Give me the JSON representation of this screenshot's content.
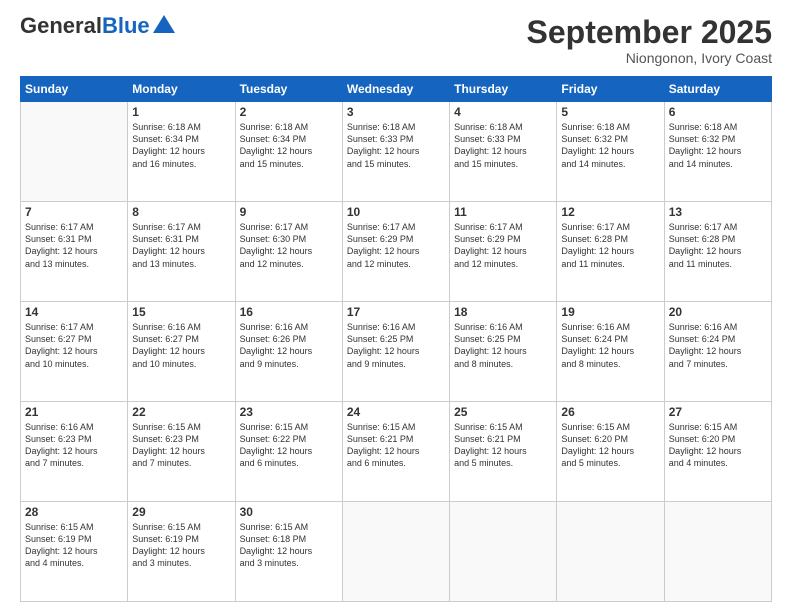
{
  "logo": {
    "general": "General",
    "blue": "Blue"
  },
  "header": {
    "month": "September 2025",
    "location": "Niongonon, Ivory Coast"
  },
  "weekdays": [
    "Sunday",
    "Monday",
    "Tuesday",
    "Wednesday",
    "Thursday",
    "Friday",
    "Saturday"
  ],
  "weeks": [
    [
      {
        "day": "",
        "info": ""
      },
      {
        "day": "1",
        "info": "Sunrise: 6:18 AM\nSunset: 6:34 PM\nDaylight: 12 hours\nand 16 minutes."
      },
      {
        "day": "2",
        "info": "Sunrise: 6:18 AM\nSunset: 6:34 PM\nDaylight: 12 hours\nand 15 minutes."
      },
      {
        "day": "3",
        "info": "Sunrise: 6:18 AM\nSunset: 6:33 PM\nDaylight: 12 hours\nand 15 minutes."
      },
      {
        "day": "4",
        "info": "Sunrise: 6:18 AM\nSunset: 6:33 PM\nDaylight: 12 hours\nand 15 minutes."
      },
      {
        "day": "5",
        "info": "Sunrise: 6:18 AM\nSunset: 6:32 PM\nDaylight: 12 hours\nand 14 minutes."
      },
      {
        "day": "6",
        "info": "Sunrise: 6:18 AM\nSunset: 6:32 PM\nDaylight: 12 hours\nand 14 minutes."
      }
    ],
    [
      {
        "day": "7",
        "info": "Sunrise: 6:17 AM\nSunset: 6:31 PM\nDaylight: 12 hours\nand 13 minutes."
      },
      {
        "day": "8",
        "info": "Sunrise: 6:17 AM\nSunset: 6:31 PM\nDaylight: 12 hours\nand 13 minutes."
      },
      {
        "day": "9",
        "info": "Sunrise: 6:17 AM\nSunset: 6:30 PM\nDaylight: 12 hours\nand 12 minutes."
      },
      {
        "day": "10",
        "info": "Sunrise: 6:17 AM\nSunset: 6:29 PM\nDaylight: 12 hours\nand 12 minutes."
      },
      {
        "day": "11",
        "info": "Sunrise: 6:17 AM\nSunset: 6:29 PM\nDaylight: 12 hours\nand 12 minutes."
      },
      {
        "day": "12",
        "info": "Sunrise: 6:17 AM\nSunset: 6:28 PM\nDaylight: 12 hours\nand 11 minutes."
      },
      {
        "day": "13",
        "info": "Sunrise: 6:17 AM\nSunset: 6:28 PM\nDaylight: 12 hours\nand 11 minutes."
      }
    ],
    [
      {
        "day": "14",
        "info": "Sunrise: 6:17 AM\nSunset: 6:27 PM\nDaylight: 12 hours\nand 10 minutes."
      },
      {
        "day": "15",
        "info": "Sunrise: 6:16 AM\nSunset: 6:27 PM\nDaylight: 12 hours\nand 10 minutes."
      },
      {
        "day": "16",
        "info": "Sunrise: 6:16 AM\nSunset: 6:26 PM\nDaylight: 12 hours\nand 9 minutes."
      },
      {
        "day": "17",
        "info": "Sunrise: 6:16 AM\nSunset: 6:25 PM\nDaylight: 12 hours\nand 9 minutes."
      },
      {
        "day": "18",
        "info": "Sunrise: 6:16 AM\nSunset: 6:25 PM\nDaylight: 12 hours\nand 8 minutes."
      },
      {
        "day": "19",
        "info": "Sunrise: 6:16 AM\nSunset: 6:24 PM\nDaylight: 12 hours\nand 8 minutes."
      },
      {
        "day": "20",
        "info": "Sunrise: 6:16 AM\nSunset: 6:24 PM\nDaylight: 12 hours\nand 7 minutes."
      }
    ],
    [
      {
        "day": "21",
        "info": "Sunrise: 6:16 AM\nSunset: 6:23 PM\nDaylight: 12 hours\nand 7 minutes."
      },
      {
        "day": "22",
        "info": "Sunrise: 6:15 AM\nSunset: 6:23 PM\nDaylight: 12 hours\nand 7 minutes."
      },
      {
        "day": "23",
        "info": "Sunrise: 6:15 AM\nSunset: 6:22 PM\nDaylight: 12 hours\nand 6 minutes."
      },
      {
        "day": "24",
        "info": "Sunrise: 6:15 AM\nSunset: 6:21 PM\nDaylight: 12 hours\nand 6 minutes."
      },
      {
        "day": "25",
        "info": "Sunrise: 6:15 AM\nSunset: 6:21 PM\nDaylight: 12 hours\nand 5 minutes."
      },
      {
        "day": "26",
        "info": "Sunrise: 6:15 AM\nSunset: 6:20 PM\nDaylight: 12 hours\nand 5 minutes."
      },
      {
        "day": "27",
        "info": "Sunrise: 6:15 AM\nSunset: 6:20 PM\nDaylight: 12 hours\nand 4 minutes."
      }
    ],
    [
      {
        "day": "28",
        "info": "Sunrise: 6:15 AM\nSunset: 6:19 PM\nDaylight: 12 hours\nand 4 minutes."
      },
      {
        "day": "29",
        "info": "Sunrise: 6:15 AM\nSunset: 6:19 PM\nDaylight: 12 hours\nand 3 minutes."
      },
      {
        "day": "30",
        "info": "Sunrise: 6:15 AM\nSunset: 6:18 PM\nDaylight: 12 hours\nand 3 minutes."
      },
      {
        "day": "",
        "info": ""
      },
      {
        "day": "",
        "info": ""
      },
      {
        "day": "",
        "info": ""
      },
      {
        "day": "",
        "info": ""
      }
    ]
  ]
}
